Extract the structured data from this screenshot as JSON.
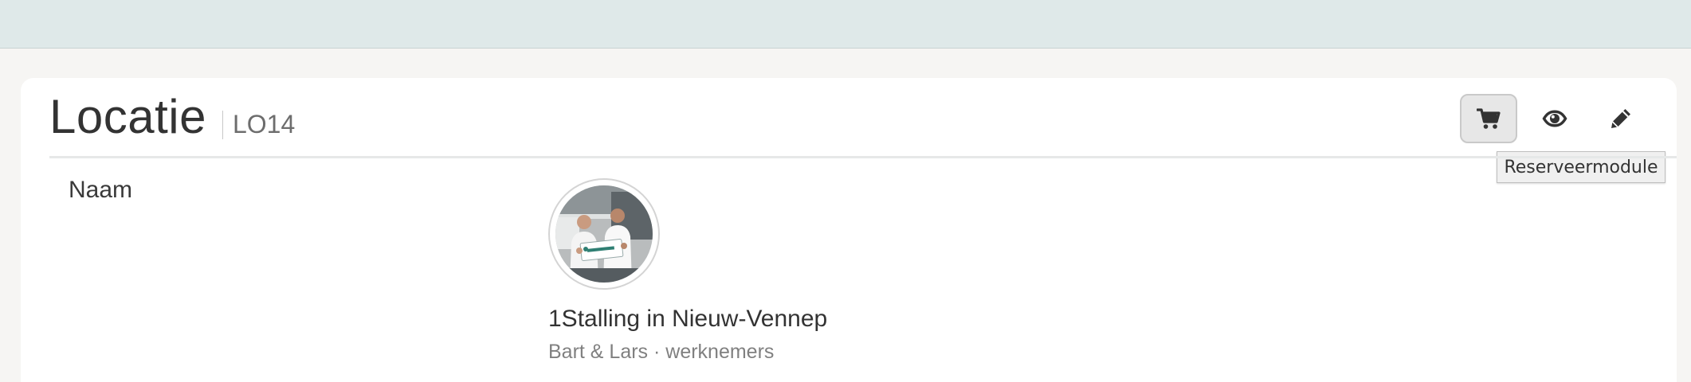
{
  "header": {
    "title": "Locatie",
    "code": "LO14"
  },
  "actions": [
    {
      "name": "reservation-module",
      "icon": "cart-icon",
      "active": true
    },
    {
      "name": "view",
      "icon": "eye-icon",
      "active": false
    },
    {
      "name": "edit",
      "icon": "pencil-icon",
      "active": false
    }
  ],
  "tooltip": {
    "text": "Reserveermodule"
  },
  "field": {
    "label": "Naam"
  },
  "item": {
    "name": "1Stalling in Nieuw-Vennep",
    "subtitle": "Bart & Lars · werknemers",
    "avatar": "photo-two-men-holding-sign"
  },
  "colors": {
    "topbar": "#dfe9e9",
    "background": "#f6f5f3",
    "card": "#ffffff",
    "text": "#333333",
    "muted": "#808080"
  }
}
